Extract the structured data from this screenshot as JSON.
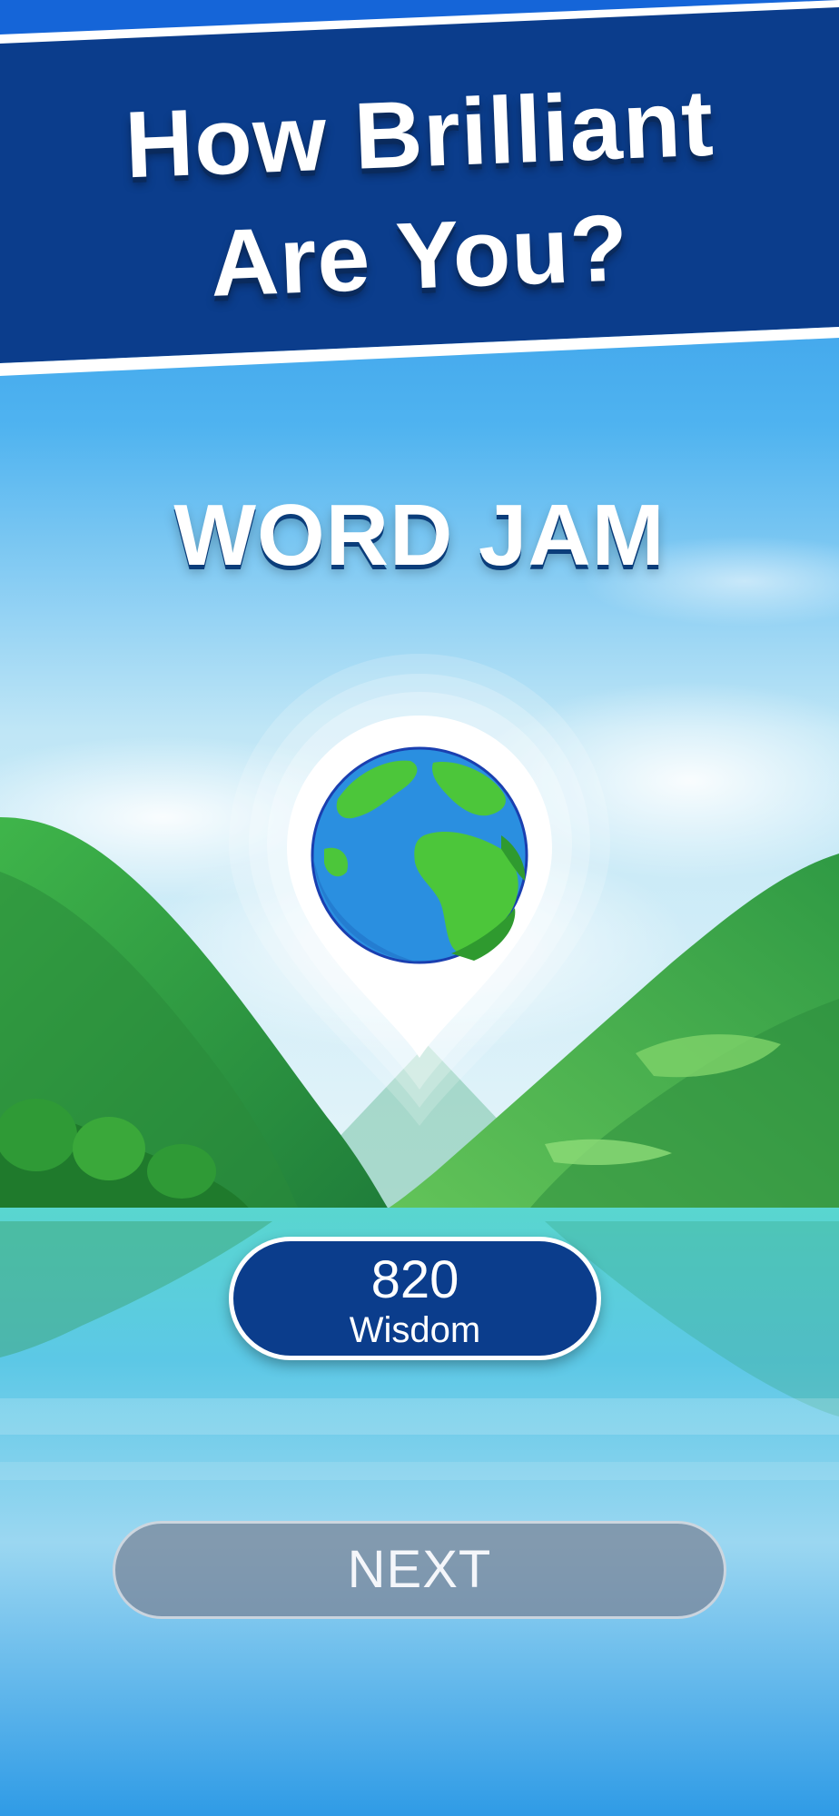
{
  "banner": {
    "headline_line1": "How Brilliant",
    "headline_line2": "Are You?"
  },
  "game": {
    "title": "WORD JAM"
  },
  "level": {
    "icon": "globe-icon",
    "score": "820",
    "score_label": "Wisdom"
  },
  "actions": {
    "next_label": "NEXT"
  },
  "colors": {
    "banner_blue": "#0b3d8c",
    "sky_top": "#2f98e8",
    "water": "#3fd0c8",
    "globe_ocean": "#2a8fe0",
    "globe_land": "#4cc63a"
  }
}
